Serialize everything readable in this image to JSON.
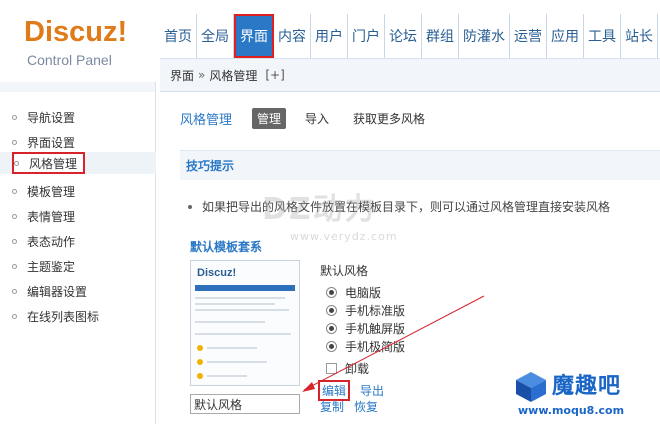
{
  "logo": {
    "main": "Discuz!",
    "sub": "Control Panel"
  },
  "topnav": {
    "items": [
      "首页",
      "全局",
      "界面",
      "内容",
      "用户",
      "门户",
      "论坛",
      "群组",
      "防灌水",
      "运营",
      "应用",
      "工具",
      "站长"
    ],
    "active_index": 2
  },
  "breadcrumb": {
    "part1": "界面",
    "sep": "»",
    "part2": "风格管理",
    "plus": "[+]"
  },
  "sidebar": {
    "items": [
      "导航设置",
      "界面设置",
      "风格管理",
      "模板管理",
      "表情管理",
      "表态动作",
      "主题鉴定",
      "编辑器设置",
      "在线列表图标"
    ],
    "active_index": 2
  },
  "main": {
    "title": "风格管理",
    "tabs": [
      "管理",
      "导入",
      "获取更多风格"
    ],
    "active_tab": 0,
    "tips_title": "技巧提示",
    "tip": "如果把导出的风格文件放置在模板目录下，则可以通过风格管理直接安装风格",
    "section_title": "默认模板套系",
    "preview_logo": "Discuz!",
    "options_label": "默认风格",
    "radio_options": [
      "电脑版",
      "手机标准版",
      "手机触屏版",
      "手机极简版"
    ],
    "uninstall_label": "卸载",
    "name_value": "默认风格",
    "actions": {
      "edit": "编辑",
      "export": "导出",
      "copy": "复制",
      "restore": "恢复"
    }
  },
  "watermark": {
    "text": "DZ动力",
    "url": "www.verydz.com"
  },
  "brand": {
    "name": "魔趣吧",
    "url": "www.moqu8.com"
  }
}
